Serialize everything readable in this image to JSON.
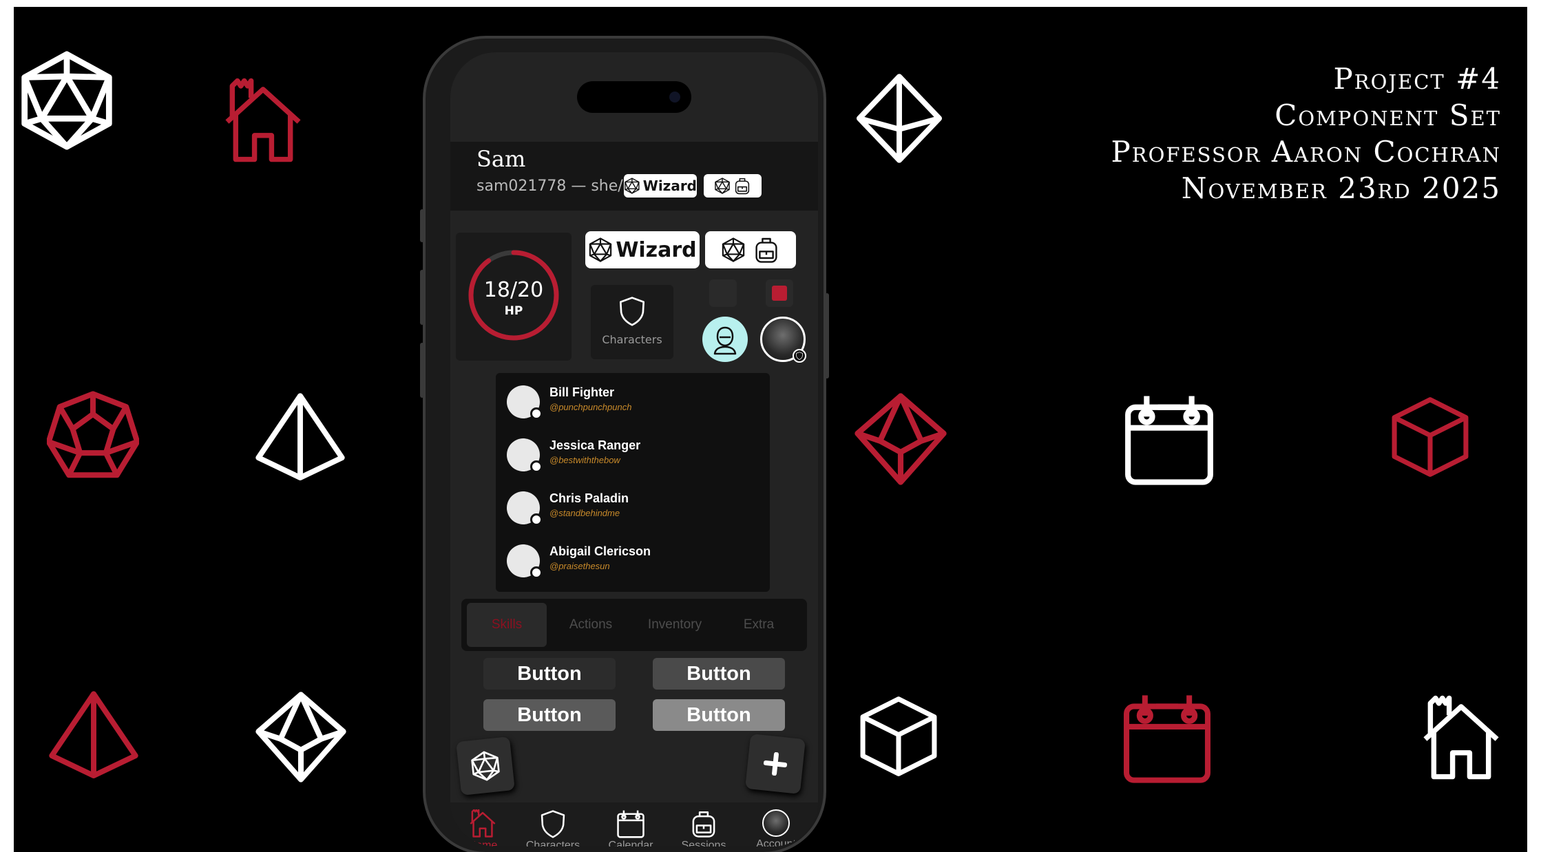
{
  "colors": {
    "background": "#000000",
    "accent": "#b81d32",
    "phone_screen": "#232323",
    "handle": "#c88a2a"
  },
  "title_block": {
    "line1": "Project #4",
    "line2": "Component Set",
    "line3": "Professor Aaron Cochran",
    "line4": "November 23rd 2025"
  },
  "decorations": [
    "d20-icon",
    "house-icon",
    "d8-icon",
    "d12-icon",
    "d4-icon",
    "d10-icon",
    "calendar-icon",
    "d6-icon",
    "d4-icon",
    "d10-icon",
    "d6-icon",
    "calendar-icon",
    "house-icon"
  ],
  "profile": {
    "name": "Sam",
    "meta": "sam021778 — she/her",
    "class_badge": "Wizard"
  },
  "stats": {
    "hp": "18/20",
    "hp_label": "HP",
    "hp_fraction": 0.9,
    "class_button": "Wizard",
    "characters_label": "Characters"
  },
  "party": [
    {
      "name": "Bill Fighter",
      "handle": "@punchpunchpunch"
    },
    {
      "name": "Jessica Ranger",
      "handle": "@bestwiththebow"
    },
    {
      "name": "Chris Paladin",
      "handle": "@standbehindme"
    },
    {
      "name": "Abigail Clericson",
      "handle": "@praisethesun"
    }
  ],
  "tabs": [
    "Skills",
    "Actions",
    "Inventory",
    "Extra"
  ],
  "active_tab": "Skills",
  "buttons": [
    "Button",
    "Button",
    "Button",
    "Button"
  ],
  "nav": [
    {
      "label": "Home",
      "icon": "house-icon"
    },
    {
      "label": "Characters",
      "icon": "shield-icon"
    },
    {
      "label": "Calendar",
      "icon": "calendar-icon"
    },
    {
      "label": "Sessions",
      "icon": "backpack-icon"
    },
    {
      "label": "Account",
      "icon": "avatar"
    }
  ],
  "active_nav": "Home"
}
